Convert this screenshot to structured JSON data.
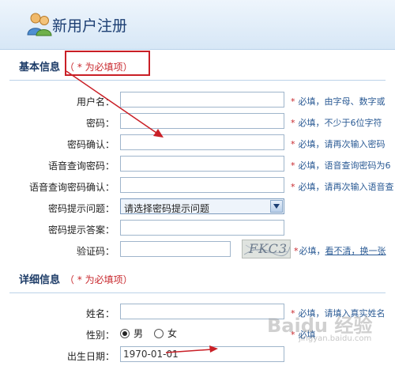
{
  "header": {
    "title": "新用户注册"
  },
  "basic": {
    "title": "基本信息",
    "note": "（ * 为必填项）",
    "fields": [
      {
        "label": "用户名：",
        "value": "",
        "hint": "必填，由字母、数字或"
      },
      {
        "label": "密码：",
        "value": "",
        "hint": "必填，不少于6位字符"
      },
      {
        "label": "密码确认：",
        "value": "",
        "hint": "必填，请再次输入密码"
      },
      {
        "label": "语音查询密码：",
        "value": "",
        "hint": "必填，语音查询密码为6"
      },
      {
        "label": "语音查询密码确认：",
        "value": "",
        "hint": "必填，请再次输入语音查"
      }
    ],
    "question": {
      "label": "密码提示问题：",
      "selected": "请选择密码提示问题"
    },
    "answer": {
      "label": "密码提示答案：",
      "value": ""
    },
    "captcha": {
      "label": "验证码：",
      "value": "",
      "image_text": "FKC3",
      "hint_prefix": "必填，",
      "refresh_link": "看不清，换一张"
    }
  },
  "detail": {
    "title": "详细信息",
    "note": "（ * 为必填项）",
    "name": {
      "label": "姓名：",
      "value": "",
      "hint": "必填，请填入真实姓名"
    },
    "gender": {
      "label": "性别：",
      "male": "男",
      "female": "女",
      "selected": "male",
      "hint": "必填"
    },
    "birthday": {
      "label": "出生日期：",
      "value": "1970-01-01"
    }
  },
  "watermark": {
    "text": "Baidu 经验",
    "sub": "jingyan.baidu.com"
  },
  "colors": {
    "required": "#c8272c",
    "hint": "#2a5a94",
    "title": "#1b3a66",
    "header_bg": "#d7e7f6"
  },
  "icons": {
    "header": "people-icon",
    "select_arrow": "chevron-down-icon"
  }
}
